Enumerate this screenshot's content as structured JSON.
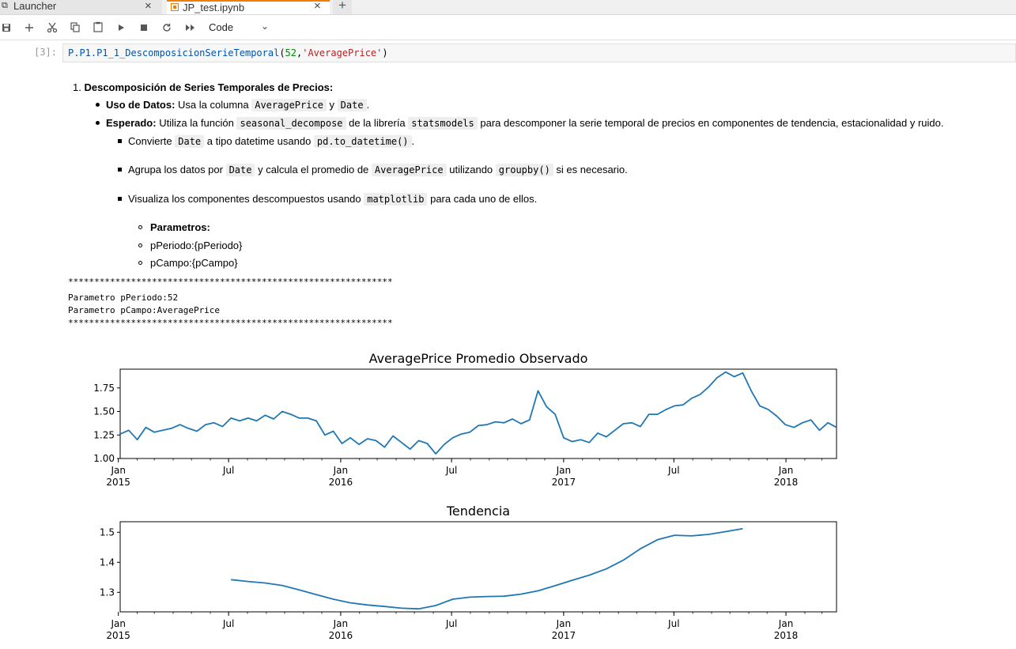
{
  "tabs": [
    {
      "label": "Launcher",
      "close": "×"
    },
    {
      "label": "JP_test.ipynb",
      "close": "×"
    }
  ],
  "tab_add": "+",
  "toolbar": {
    "icons": [
      "save-icon",
      "add-icon",
      "cut-icon",
      "copy-icon",
      "paste-icon",
      "run-icon",
      "stop-icon",
      "restart-icon",
      "fast-forward-icon"
    ],
    "cell_type": "Code"
  },
  "cell": {
    "prompt": "[3]:",
    "code_module": "P.P1.P1_1_DescomposicionSerieTemporal",
    "code_open": "(",
    "code_num": "52",
    "code_comma": ",",
    "code_str": "'AveragePrice'",
    "code_close": ")"
  },
  "markdown": {
    "num": "1.",
    "heading": "Descomposición de Series Temporales de Precios:",
    "uso_label": "Uso de Datos:",
    "uso_text1": " Usa la columna ",
    "uso_code1": "AveragePrice",
    "uso_text2": " y ",
    "uso_code2": "Date",
    "uso_text3": ".",
    "esp_label": "Esperado:",
    "esp_text1": " Utiliza la función ",
    "esp_code1": "seasonal_decompose",
    "esp_text2": " de la librería ",
    "esp_code2": "statsmodels",
    "esp_text3": " para descomponer la serie temporal de precios en componentes de tendencia, estacionalidad y ruido.",
    "sub1_text1": "Convierte ",
    "sub1_code1": "Date",
    "sub1_text2": " a tipo datetime usando ",
    "sub1_code2": "pd.to_datetime()",
    "sub1_text3": ".",
    "sub2_text1": "Agrupa los datos por ",
    "sub2_code1": "Date",
    "sub2_text2": " y calcula el promedio de ",
    "sub2_code2": "AveragePrice",
    "sub2_text3": " utilizando ",
    "sub2_code3": "groupby()",
    "sub2_text4": " si es necesario.",
    "sub3_text1": "Visualiza los componentes descompuestos usando ",
    "sub3_code1": "matplotlib",
    "sub3_text2": " para cada uno de ellos.",
    "param_heading": "Parametros:",
    "param1": "pPeriodo:{pPeriodo}",
    "param2": "pCampo:{pCampo}"
  },
  "stdout": {
    "stars": "**************************************************************",
    "line1": "Parametro pPeriodo:52",
    "line2": "Parametro pCampo:AveragePrice"
  },
  "colors": {
    "line": "#1f77b4",
    "accent": "#f57c00"
  },
  "chart_data": [
    {
      "type": "line",
      "title": "AveragePrice Promedio Observado",
      "ylim": [
        1.0,
        1.95
      ],
      "yticks": [
        1.0,
        1.25,
        1.5,
        1.75
      ],
      "ytick_labels": [
        "1.00",
        "1.25",
        "1.50",
        "1.75"
      ],
      "xlim": [
        "2015-01-04",
        "2018-03-25"
      ],
      "xticks": [
        {
          "date": "2015-01-01",
          "label": "Jan",
          "sublabel": "2015"
        },
        {
          "date": "2015-07-01",
          "label": "Jul",
          "sublabel": ""
        },
        {
          "date": "2016-01-01",
          "label": "Jan",
          "sublabel": "2016"
        },
        {
          "date": "2016-07-01",
          "label": "Jul",
          "sublabel": ""
        },
        {
          "date": "2017-01-01",
          "label": "Jan",
          "sublabel": "2017"
        },
        {
          "date": "2017-07-01",
          "label": "Jul",
          "sublabel": ""
        },
        {
          "date": "2018-01-01",
          "label": "Jan",
          "sublabel": "2018"
        }
      ],
      "x": [
        "2015-01-04",
        "2015-01-18",
        "2015-02-01",
        "2015-02-15",
        "2015-03-01",
        "2015-03-15",
        "2015-03-29",
        "2015-04-12",
        "2015-04-26",
        "2015-05-10",
        "2015-05-24",
        "2015-06-07",
        "2015-06-21",
        "2015-07-05",
        "2015-07-19",
        "2015-08-02",
        "2015-08-16",
        "2015-08-30",
        "2015-09-13",
        "2015-09-27",
        "2015-10-11",
        "2015-10-25",
        "2015-11-08",
        "2015-11-22",
        "2015-12-06",
        "2015-12-20",
        "2016-01-03",
        "2016-01-17",
        "2016-01-31",
        "2016-02-14",
        "2016-02-28",
        "2016-03-13",
        "2016-03-27",
        "2016-04-10",
        "2016-04-24",
        "2016-05-08",
        "2016-05-22",
        "2016-06-05",
        "2016-06-19",
        "2016-07-03",
        "2016-07-17",
        "2016-07-31",
        "2016-08-14",
        "2016-08-28",
        "2016-09-11",
        "2016-09-25",
        "2016-10-09",
        "2016-10-23",
        "2016-11-06",
        "2016-11-20",
        "2016-12-04",
        "2016-12-18",
        "2017-01-01",
        "2017-01-15",
        "2017-01-29",
        "2017-02-12",
        "2017-02-26",
        "2017-03-12",
        "2017-03-26",
        "2017-04-09",
        "2017-04-23",
        "2017-05-07",
        "2017-05-21",
        "2017-06-04",
        "2017-06-18",
        "2017-07-02",
        "2017-07-16",
        "2017-07-30",
        "2017-08-13",
        "2017-08-27",
        "2017-09-10",
        "2017-09-24",
        "2017-10-08",
        "2017-10-22",
        "2017-11-05",
        "2017-11-19",
        "2017-12-03",
        "2017-12-17",
        "2017-12-31",
        "2018-01-14",
        "2018-01-28",
        "2018-02-11",
        "2018-02-25",
        "2018-03-11",
        "2018-03-25"
      ],
      "series": [
        {
          "values": [
            1.26,
            1.3,
            1.2,
            1.33,
            1.28,
            1.3,
            1.32,
            1.36,
            1.32,
            1.29,
            1.36,
            1.38,
            1.34,
            1.43,
            1.4,
            1.43,
            1.4,
            1.46,
            1.42,
            1.5,
            1.47,
            1.43,
            1.43,
            1.4,
            1.25,
            1.29,
            1.16,
            1.22,
            1.15,
            1.21,
            1.19,
            1.12,
            1.24,
            1.17,
            1.1,
            1.19,
            1.16,
            1.05,
            1.15,
            1.22,
            1.26,
            1.28,
            1.35,
            1.36,
            1.39,
            1.38,
            1.42,
            1.37,
            1.41,
            1.72,
            1.55,
            1.47,
            1.22,
            1.18,
            1.2,
            1.17,
            1.27,
            1.23,
            1.3,
            1.37,
            1.38,
            1.34,
            1.47,
            1.47,
            1.52,
            1.56,
            1.57,
            1.64,
            1.68,
            1.76,
            1.86,
            1.92,
            1.87,
            1.91,
            1.72,
            1.56,
            1.52,
            1.45,
            1.36,
            1.33,
            1.38,
            1.41,
            1.3,
            1.38,
            1.33
          ]
        }
      ]
    },
    {
      "type": "line",
      "title": "Tendencia",
      "ylim": [
        1.235,
        1.535
      ],
      "yticks": [
        1.3,
        1.4,
        1.5
      ],
      "ytick_labels": [
        "1.3",
        "1.4",
        "1.5"
      ],
      "xlim": [
        "2015-01-04",
        "2018-03-25"
      ],
      "xticks": [
        {
          "date": "2015-01-01",
          "label": "Jan",
          "sublabel": "2015"
        },
        {
          "date": "2015-07-01",
          "label": "Jul",
          "sublabel": ""
        },
        {
          "date": "2016-01-01",
          "label": "Jan",
          "sublabel": "2016"
        },
        {
          "date": "2016-07-01",
          "label": "Jul",
          "sublabel": ""
        },
        {
          "date": "2017-01-01",
          "label": "Jan",
          "sublabel": "2017"
        },
        {
          "date": "2017-07-01",
          "label": "Jul",
          "sublabel": ""
        },
        {
          "date": "2018-01-01",
          "label": "Jan",
          "sublabel": "2018"
        }
      ],
      "x": [
        "2015-07-05",
        "2015-08-02",
        "2015-08-30",
        "2015-09-27",
        "2015-10-25",
        "2015-11-22",
        "2015-12-20",
        "2016-01-17",
        "2016-02-14",
        "2016-03-13",
        "2016-04-10",
        "2016-05-08",
        "2016-06-05",
        "2016-07-03",
        "2016-07-31",
        "2016-08-28",
        "2016-09-25",
        "2016-10-23",
        "2016-11-20",
        "2016-12-18",
        "2017-01-15",
        "2017-02-12",
        "2017-03-12",
        "2017-04-09",
        "2017-05-07",
        "2017-06-04",
        "2017-07-02",
        "2017-07-30",
        "2017-08-27",
        "2017-09-24",
        "2017-10-22"
      ],
      "series": [
        {
          "values": [
            1.342,
            1.336,
            1.331,
            1.323,
            1.308,
            1.292,
            1.277,
            1.265,
            1.258,
            1.253,
            1.247,
            1.245,
            1.256,
            1.277,
            1.284,
            1.286,
            1.287,
            1.294,
            1.305,
            1.322,
            1.34,
            1.357,
            1.378,
            1.407,
            1.445,
            1.475,
            1.49,
            1.488,
            1.493,
            1.502,
            1.512
          ]
        }
      ]
    }
  ]
}
